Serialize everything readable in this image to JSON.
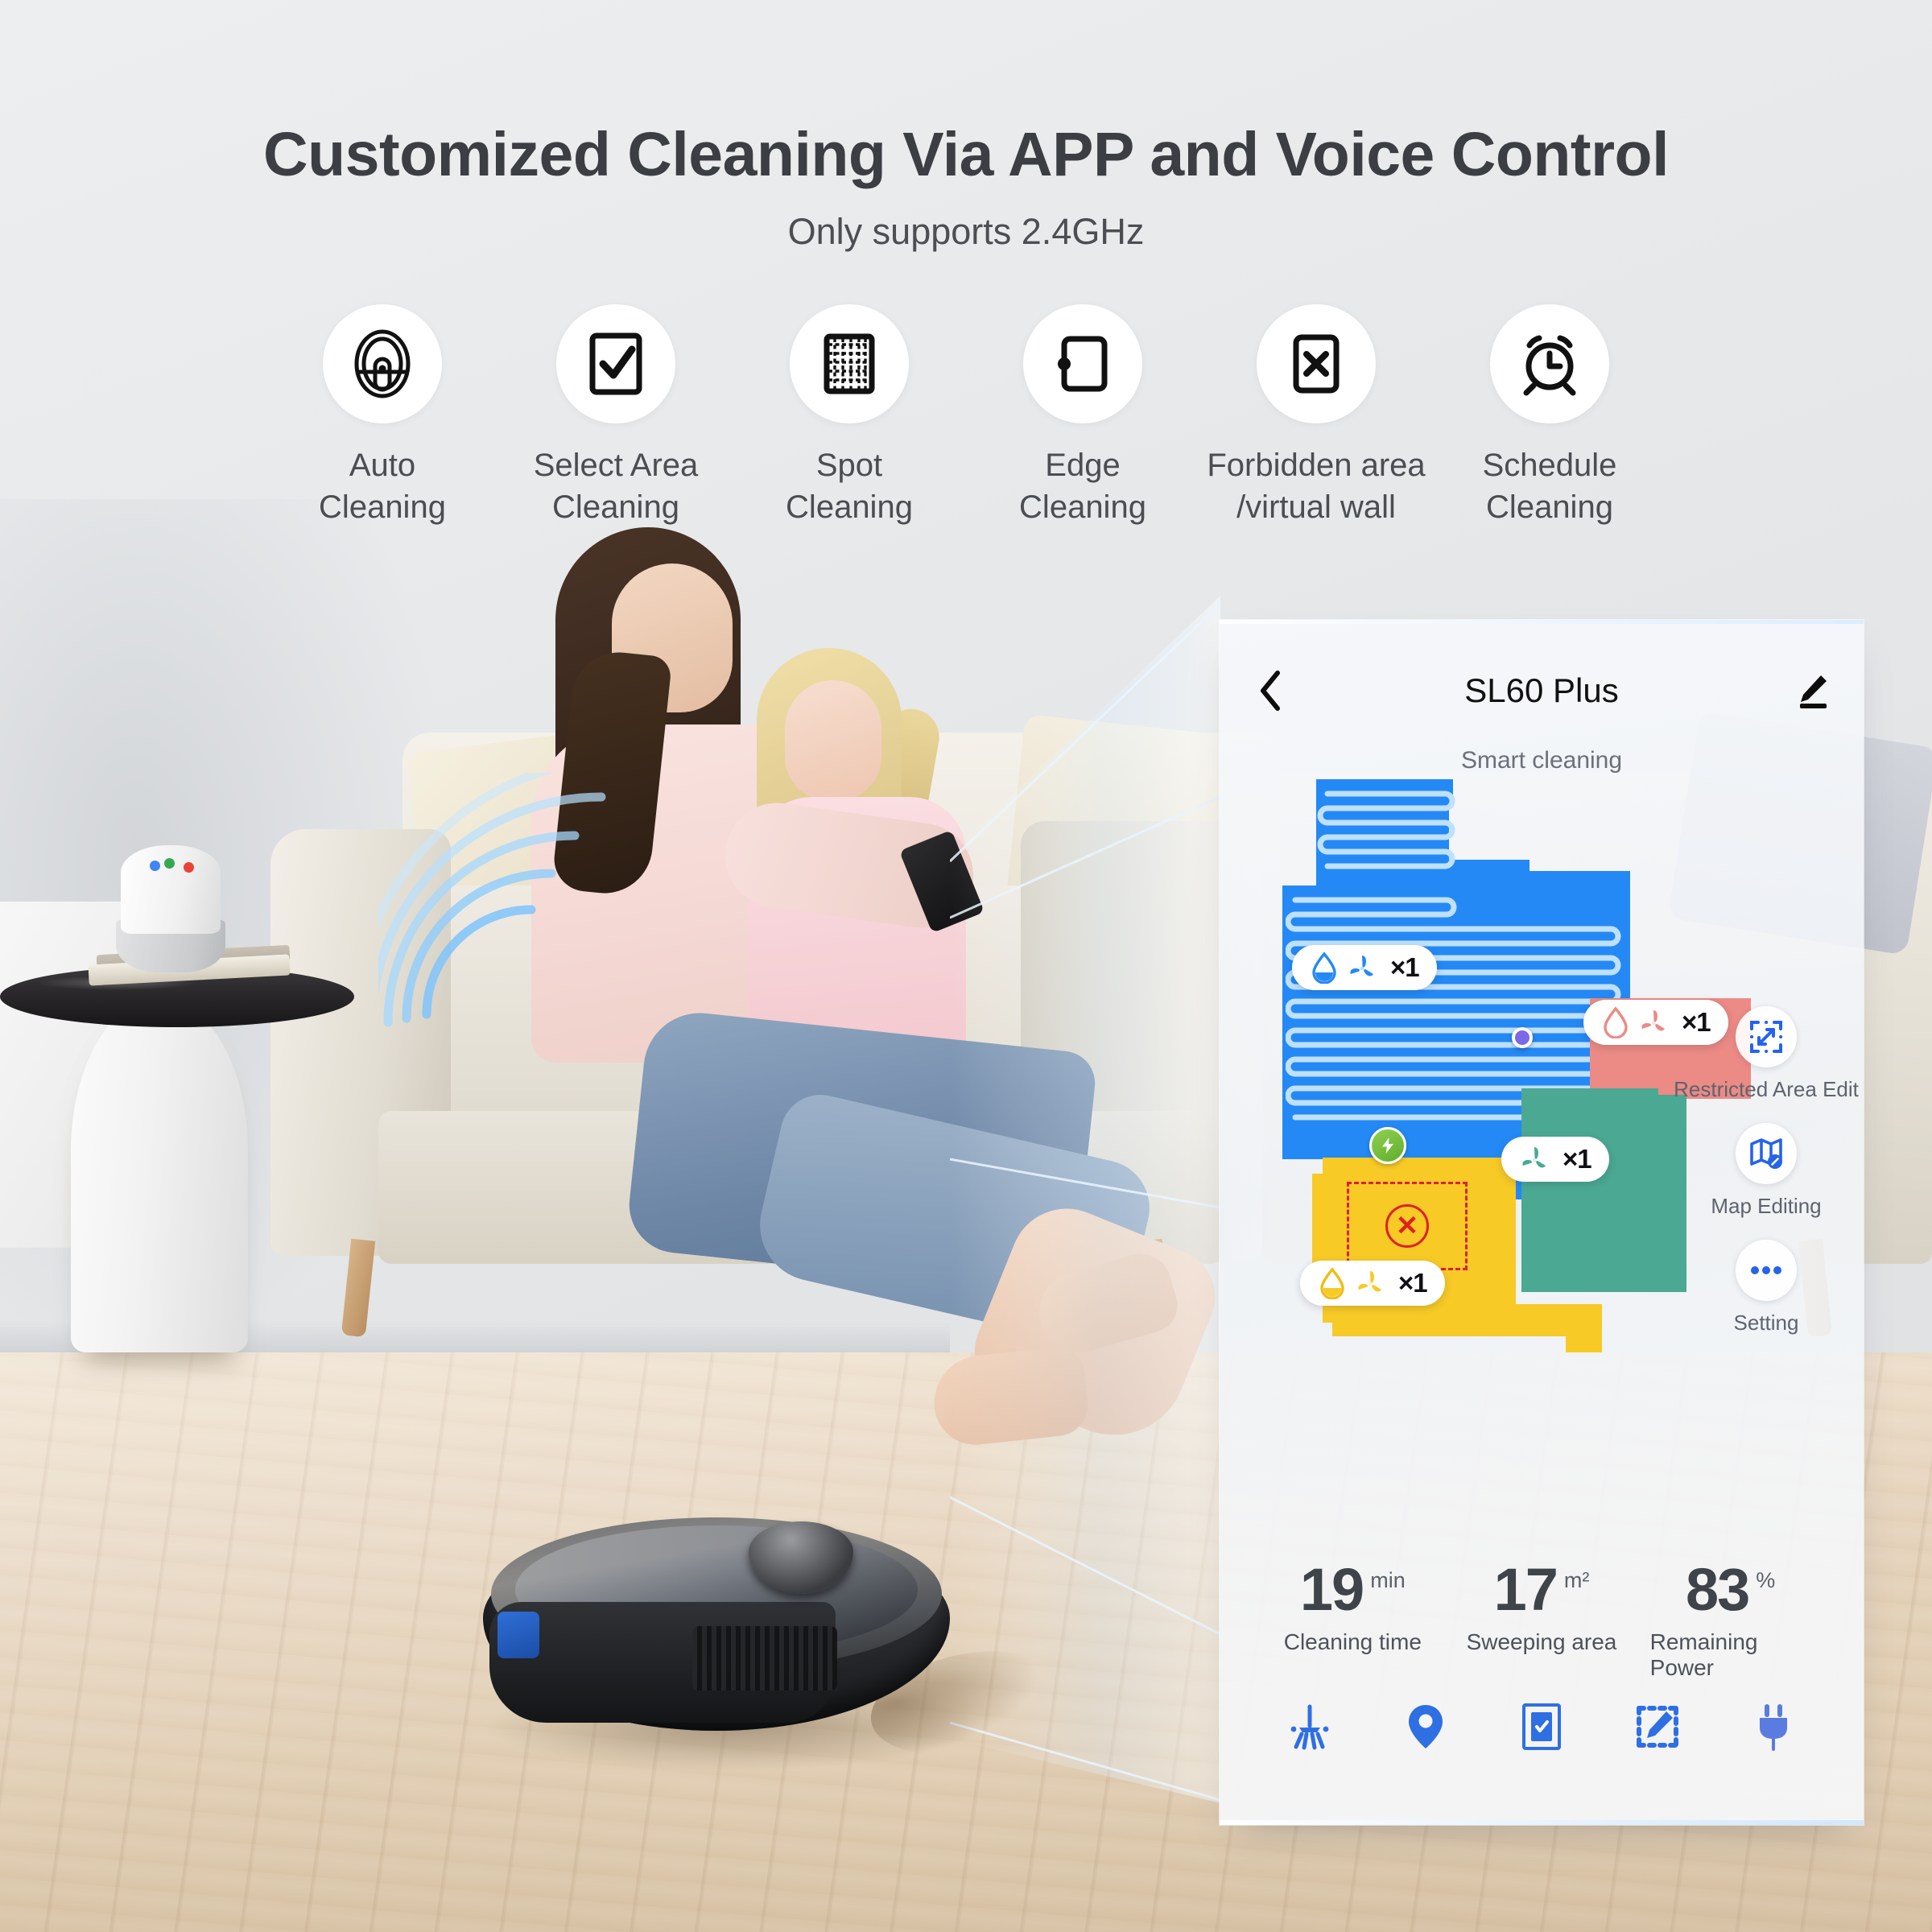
{
  "headline": "Customized Cleaning Via APP and Voice Control",
  "subheadline": "Only supports 2.4GHz",
  "features": [
    {
      "icon": "robot-vacuum-icon",
      "label": "Auto\nCleaning"
    },
    {
      "icon": "checkbox-check-icon",
      "label": "Select Area\nCleaning"
    },
    {
      "icon": "grid-spot-icon",
      "label": "Spot\nCleaning"
    },
    {
      "icon": "edge-room-icon",
      "label": "Edge\nCleaning"
    },
    {
      "icon": "forbidden-x-icon",
      "label": "Forbidden area\n/virtual wall"
    },
    {
      "icon": "alarm-clock-icon",
      "label": "Schedule\nCleaning"
    }
  ],
  "app": {
    "back_label": "‹",
    "title": "SL60 Plus",
    "edit_label": "✎",
    "status": "Smart cleaning",
    "map": {
      "room_badges": [
        {
          "id": "blue-room",
          "water": "filled",
          "fan": true,
          "count": "×1",
          "color": "#2489f5"
        },
        {
          "id": "red-room",
          "water": "outline",
          "fan": true,
          "count": "×1",
          "color": "#ec8a85"
        },
        {
          "id": "green-room",
          "water": "none",
          "fan": true,
          "count": "×1",
          "color": "#4ba892"
        },
        {
          "id": "yellow-room",
          "water": "filled",
          "fan": true,
          "count": "×1",
          "color": "#f7ca26"
        }
      ],
      "dock_icon": "charging-dock-icon",
      "robot_icon": "robot-position-icon",
      "forbidden_icon": "forbidden-zone-icon",
      "colors": {
        "blue": "#2489f5",
        "red": "#ec8a85",
        "green": "#4ba892",
        "yellow": "#f7ca26",
        "forbidden": "#e02020",
        "dock": "#6fbf38",
        "robot": "#7b68e8",
        "accent": "#2563eb"
      }
    },
    "tools": [
      {
        "icon": "restricted-area-edit-icon",
        "label": "Restricted Area Edit"
      },
      {
        "icon": "map-editing-icon",
        "label": "Map Editing"
      },
      {
        "icon": "more-dots-icon",
        "label": "Setting"
      }
    ],
    "stats": [
      {
        "value": "19",
        "unit": "min",
        "label": "Cleaning time"
      },
      {
        "value": "17",
        "unit": "m²",
        "label": "Sweeping area"
      },
      {
        "value": "83",
        "unit": "%",
        "label": "Remaining Power"
      }
    ],
    "bottom_bar": [
      {
        "icon": "broom-clean-icon"
      },
      {
        "icon": "location-pin-icon"
      },
      {
        "icon": "select-area-icon"
      },
      {
        "icon": "zone-edit-icon"
      },
      {
        "icon": "charge-plug-icon"
      }
    ]
  }
}
